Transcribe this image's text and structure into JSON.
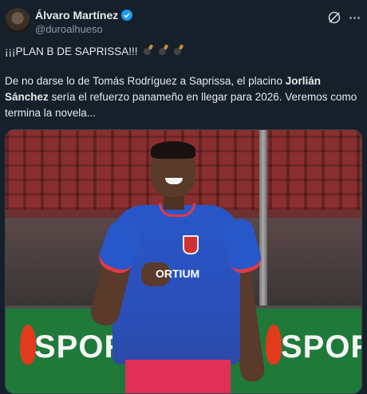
{
  "author": {
    "display_name": "Álvaro Martínez",
    "handle": "@duroalhueso",
    "verified": true
  },
  "tweet": {
    "line1": "¡¡¡PLAN B DE SAPRISSA!!!",
    "line1_emojis": [
      "bomb-icon",
      "bomb-icon",
      "bomb-icon"
    ],
    "p2_part1": "De no darse lo de Tomás Rodríguez a Saprissa, el placino ",
    "p2_bold": "Jorlián Sánchez",
    "p2_part2": " sería el refuerzo panameño en llegar para 2026. Veremos como termina la novela..."
  },
  "media": {
    "sponsor_text": "ORTIUM",
    "banner_text": "SPORA"
  },
  "colors": {
    "background": "#15202b",
    "verified": "#1d9bf0",
    "jersey": "#2857c9",
    "jersey_trim": "#e43a44",
    "shorts": "#e03058",
    "banner": "#1f7a3a"
  }
}
